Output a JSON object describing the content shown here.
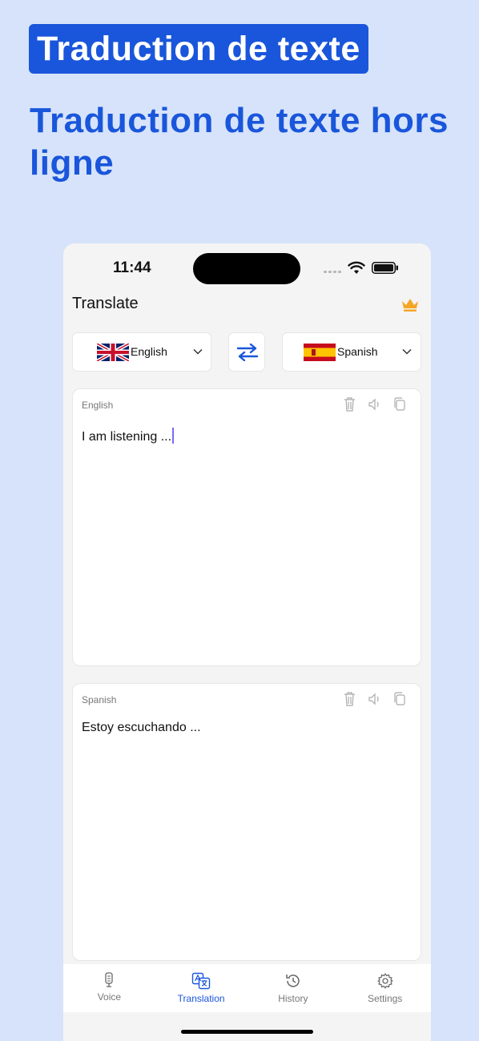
{
  "promo": {
    "badge": "Traduction de texte",
    "subtitle": "Traduction de texte hors ligne"
  },
  "status_bar": {
    "time": "11:44"
  },
  "header": {
    "title": "Translate",
    "premium_icon": "crown-icon"
  },
  "languages": {
    "source": {
      "name": "English",
      "flag": "uk-flag"
    },
    "target": {
      "name": "Spanish",
      "flag": "spain-flag"
    }
  },
  "source_card": {
    "label": "English",
    "text": "I am listening ..."
  },
  "target_card": {
    "label": "Spanish",
    "text": "Estoy escuchando ..."
  },
  "tabs": [
    {
      "label": "Voice",
      "icon": "microphone-icon"
    },
    {
      "label": "Translation",
      "icon": "translate-icon"
    },
    {
      "label": "History",
      "icon": "history-icon"
    },
    {
      "label": "Settings",
      "icon": "gear-icon"
    }
  ],
  "colors": {
    "accent": "#1a56db",
    "background": "#d6e3fa",
    "crown": "#f5a623"
  }
}
